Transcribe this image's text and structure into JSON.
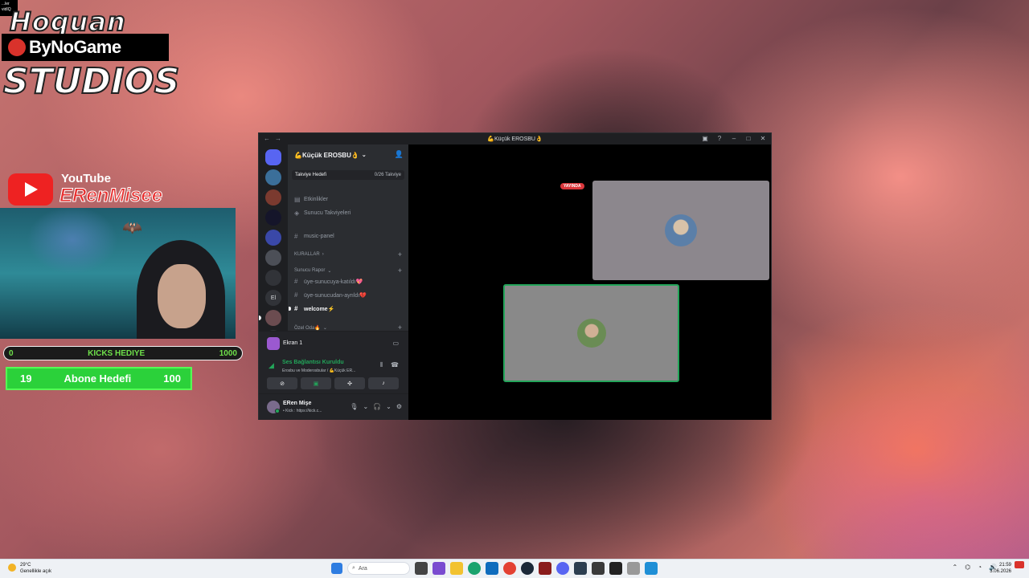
{
  "overlay": {
    "corner_tag": "...ler\nvidIQ",
    "brand_top": "Hoquan",
    "brand_main": "ByNoGame",
    "brand_sub": "STUDIOS",
    "youtube_word": "YouTube",
    "channel_name": "ERenMisee",
    "kicks_bar": {
      "left": "0",
      "label": "KICKS HEDIYE",
      "right": "1000"
    },
    "abone_bar": {
      "left": "19",
      "label": "Abone Hedefi",
      "right": "100"
    }
  },
  "discord": {
    "window_title": "💪Küçük EROSBU👌",
    "server_name": "💪Küçük EROSBU👌",
    "boost": {
      "label": "Takviye Hedefi",
      "progress": "0/26 Takviye"
    },
    "channels": [
      {
        "type": "event",
        "name": "Etkinlikler"
      },
      {
        "type": "boost",
        "name": "Sunucu Takviyeleri"
      },
      {
        "type": "text",
        "name": "music-panel"
      }
    ],
    "category_rules": "KURALLAR",
    "category_report": "Sunucu Rapor",
    "report_channels": [
      {
        "name": "üye-sunucuya-katıldı💖"
      },
      {
        "name": "üye-sunucudan-ayrıldı💔"
      },
      {
        "name": "welcome⚡"
      }
    ],
    "category_private": "Özel Oda🔥",
    "stream_row_label": "Ekran 1",
    "voice": {
      "status": "Ses Bağlantısı Kuruldu",
      "sub": "Erosbu ve Moderosbular / 💪Küçük ER..."
    },
    "user": {
      "name": "ERen Mişe",
      "status": "• Kick : https://kick.c..."
    },
    "live_badge": "YAYINDA",
    "colors": {
      "accent_green": "#23a55a",
      "live_red": "#da373c",
      "sidebar": "#2b2d31",
      "rail": "#1e1f22"
    }
  },
  "taskbar": {
    "weather_temp": "29°C",
    "weather_desc": "Genellikle açık",
    "search_placeholder": "Ara",
    "time": "21:59",
    "date": "3.06.2026"
  }
}
